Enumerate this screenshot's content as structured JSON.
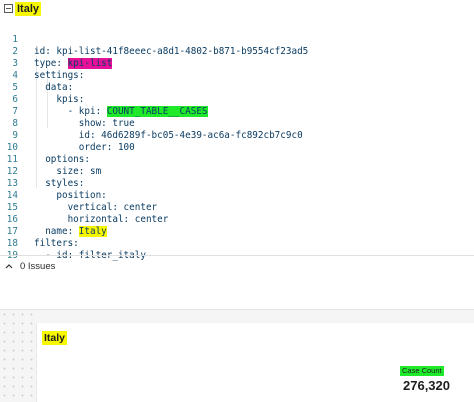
{
  "header": {
    "tab_label": "Italy"
  },
  "editor": {
    "line_numbers": [
      "1",
      "2",
      "3",
      "4",
      "5",
      "6",
      "7",
      "8",
      "9",
      "10",
      "11",
      "12",
      "13",
      "14",
      "15",
      "16",
      "17",
      "18",
      "19"
    ],
    "l1_key": "id: ",
    "l1_val": "kpi-list-41f8eeec-a8d1-4802-b871-b9554cf23ad5",
    "l2_key": "type: ",
    "l2_val": "kpi-list",
    "l3": "settings:",
    "l4": "  data:",
    "l5": "    kpis:",
    "l6_key": "      - kpi: ",
    "l6_val": "COUNT_TABLE__CASES",
    "l7": "        show: true",
    "l8": "        id: 46d6289f-bc05-4e39-ac6a-fc892cb7c9c0",
    "l9": "        order: 100",
    "l10": "  options:",
    "l11": "    size: sm",
    "l12": "  styles:",
    "l13": "    position:",
    "l14": "      vertical: center",
    "l15": "      horizontal: center",
    "l16_key": "  name: ",
    "l16_val": "Italy",
    "l17": "filters:",
    "l18": "  - id: filter_italy",
    "l19": ""
  },
  "issues": {
    "label": "0 Issues"
  },
  "preview": {
    "card_title": "Italy",
    "kpi_label": "Case Count",
    "kpi_value": "276,320"
  },
  "colors": {
    "highlight_yellow": "#f7f700",
    "highlight_green": "#1eea2a",
    "highlight_magenta": "#e7109a",
    "code_text": "#0b3d63",
    "line_number": "#2f7c8f"
  }
}
